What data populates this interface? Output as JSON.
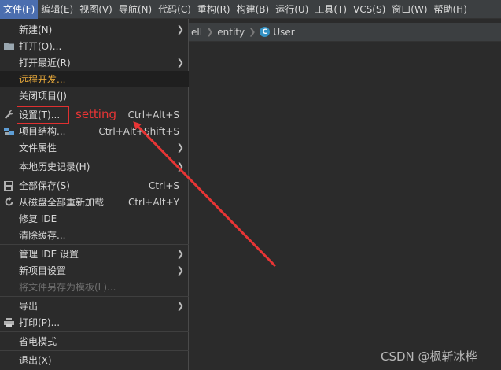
{
  "menubar": {
    "items": [
      {
        "label": "文件(F)"
      },
      {
        "label": "编辑(E)"
      },
      {
        "label": "视图(V)"
      },
      {
        "label": "导航(N)"
      },
      {
        "label": "代码(C)"
      },
      {
        "label": "重构(R)"
      },
      {
        "label": "构建(B)"
      },
      {
        "label": "运行(U)"
      },
      {
        "label": "工具(T)"
      },
      {
        "label": "VCS(S)"
      },
      {
        "label": "窗口(W)"
      },
      {
        "label": "帮助(H)"
      }
    ]
  },
  "breadcrumb": {
    "items": [
      "ell",
      "entity",
      "User"
    ],
    "class_icon": "C"
  },
  "file_menu": {
    "items": [
      {
        "label": "新建(N)",
        "submenu": true
      },
      {
        "label": "打开(O)...",
        "icon": "folder-icon"
      },
      {
        "label": "打开最近(R)",
        "submenu": true
      },
      {
        "label": "远程开发..."
      },
      {
        "label": "关闭项目(J)"
      },
      {
        "label": "设置(T)...",
        "shortcut": "Ctrl+Alt+S",
        "icon": "wrench-icon"
      },
      {
        "label": "项目结构...",
        "shortcut": "Ctrl+Alt+Shift+S",
        "icon": "project-structure-icon"
      },
      {
        "label": "文件属性",
        "submenu": true
      },
      {
        "label": "本地历史记录(H)",
        "submenu": true
      },
      {
        "label": "全部保存(S)",
        "shortcut": "Ctrl+S",
        "icon": "save-icon"
      },
      {
        "label": "从磁盘全部重新加载",
        "shortcut": "Ctrl+Alt+Y",
        "icon": "reload-icon"
      },
      {
        "label": "修复 IDE"
      },
      {
        "label": "清除缓存..."
      },
      {
        "label": "管理 IDE 设置",
        "submenu": true
      },
      {
        "label": "新项目设置",
        "submenu": true
      },
      {
        "label": "将文件另存为模板(L)...",
        "disabled": true
      },
      {
        "label": "导出",
        "submenu": true
      },
      {
        "label": "打印(P)...",
        "icon": "print-icon"
      },
      {
        "label": "省电模式"
      },
      {
        "label": "退出(X)"
      }
    ]
  },
  "annotation": {
    "text": "setting",
    "color": "#e83535"
  },
  "watermark": "CSDN @枫斩冰桦",
  "colors": {
    "accent": "#4b6eaf",
    "highlight_text": "#e8a93a",
    "background": "#2b2b2b",
    "menubar": "#3c3f41"
  }
}
